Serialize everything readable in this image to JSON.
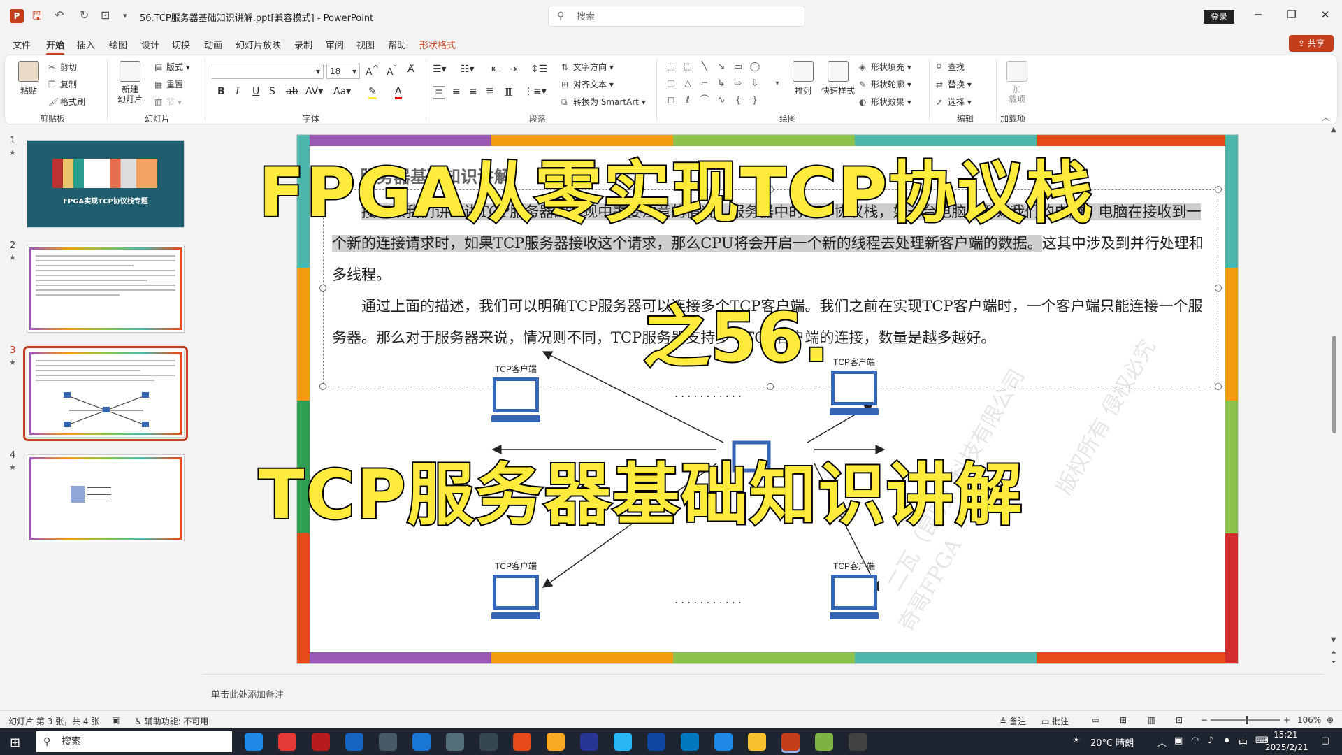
{
  "titlebar": {
    "logo_letter": "P",
    "doc_title": "56.TCP服务器基础知识讲解.ppt[兼容模式]  -  PowerPoint",
    "search_placeholder": "搜索",
    "login_label": "登录",
    "minimize": "─",
    "maximize": "❐",
    "close": "✕"
  },
  "tabs": [
    "文件",
    "开始",
    "插入",
    "绘图",
    "设计",
    "切换",
    "动画",
    "幻灯片放映",
    "录制",
    "审阅",
    "视图",
    "帮助",
    "形状格式"
  ],
  "share_label": "共享",
  "ribbon": {
    "clipboard": {
      "paste": "粘贴",
      "cut": "剪切",
      "copy": "复制",
      "painter": "格式刷",
      "label": "剪贴板"
    },
    "slides": {
      "new_slide": "新建\n幻灯片",
      "layout": "版式",
      "reset": "重置",
      "section": "节",
      "label": "幻灯片"
    },
    "font": {
      "font_name": "",
      "font_size": "18",
      "label": "字体"
    },
    "paragraph": {
      "text_direction": "文字方向",
      "align_text": "对齐文本",
      "smartart": "转换为 SmartArt",
      "label": "段落"
    },
    "drawing": {
      "arrange": "排列",
      "quick_styles": "快速样式",
      "shape_fill": "形状填充",
      "shape_outline": "形状轮廓",
      "shape_effects": "形状效果",
      "label": "绘图"
    },
    "editing": {
      "find": "查找",
      "replace": "替换",
      "select": "选择",
      "label": "编辑"
    },
    "addins": {
      "addins": "加\n载项",
      "label": "加载项"
    }
  },
  "thumbnails": [
    {
      "num": "1",
      "title": "FPGA实现TCP协议栈专题"
    },
    {
      "num": "2"
    },
    {
      "num": "3"
    },
    {
      "num": "4"
    }
  ],
  "slide": {
    "ghost_title": "服务器基础知识讲解",
    "para1_pre": "接下来我们讲一讲TCP服务器的实现中需要注意的情况，服务器中的TCP协议栈，如一台电脑，例如我们的电脑。电脑在接收到一个新的连接请求时，如果TCP服务器接收这个请求，那么CPU将会开启一个新的线程去处理新客户端的数据。",
    "para1_post": "这其中涉及到并行处理和多线程。",
    "para2": "通过上面的描述，我们可以明确TCP服务器可以连接多个TCP客户端。我们之前在实现TCP客户端时，一个客户端只能连接一个服务器。那么对于服务器来说，情况则不同，TCP服务器支持多个TCP客户端的连接，数量是越多越好。",
    "client_label": "TCP客户端",
    "dots": "...........",
    "watermark1": "奇哥FPGA",
    "watermark2": "版权所有 侵权必究",
    "watermark3": "二瓦（昆明）科技有限公司"
  },
  "captions": {
    "line1": "FPGA从零实现TCP协议栈",
    "line2": "之56.",
    "line3": "TCP服务器基础知识讲解"
  },
  "notes_placeholder": "单击此处添加备注",
  "status": {
    "slide_info": "幻灯片 第 3 张，共 4 张",
    "accessibility": "辅助功能: 不可用",
    "notes": "备注",
    "comments": "批注",
    "zoom": "106%"
  },
  "taskbar": {
    "search": "搜索",
    "weather": "20°C  晴朗",
    "ime": "中",
    "time": "15:21",
    "date": "2025/2/21"
  },
  "colors": {
    "accent": "#c43e1c",
    "caption_fill": "#ffeb3b",
    "pc_blue": "#3566b3"
  }
}
